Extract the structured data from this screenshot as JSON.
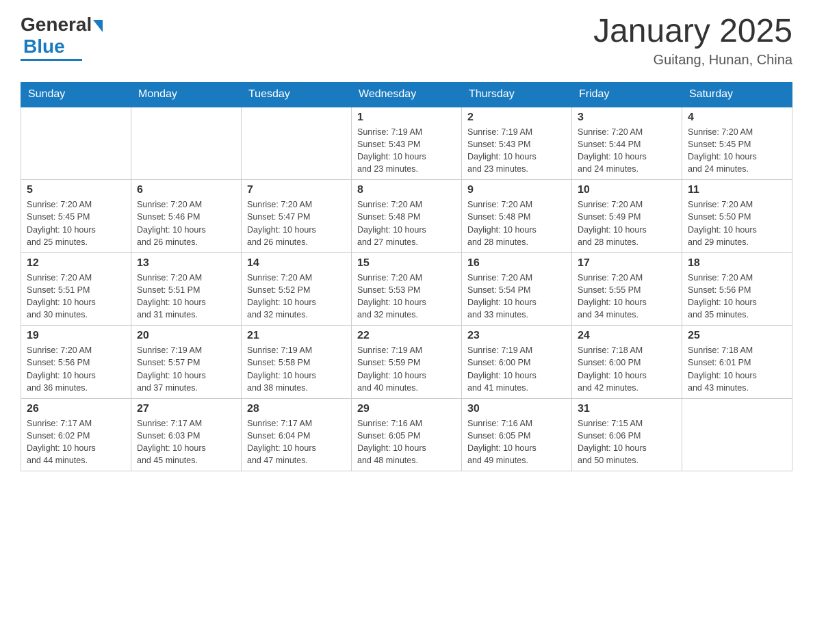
{
  "header": {
    "logo_general": "General",
    "logo_blue": "Blue",
    "month_title": "January 2025",
    "location": "Guitang, Hunan, China"
  },
  "days_of_week": [
    "Sunday",
    "Monday",
    "Tuesday",
    "Wednesday",
    "Thursday",
    "Friday",
    "Saturday"
  ],
  "weeks": [
    [
      {
        "day": "",
        "info": ""
      },
      {
        "day": "",
        "info": ""
      },
      {
        "day": "",
        "info": ""
      },
      {
        "day": "1",
        "info": "Sunrise: 7:19 AM\nSunset: 5:43 PM\nDaylight: 10 hours\nand 23 minutes."
      },
      {
        "day": "2",
        "info": "Sunrise: 7:19 AM\nSunset: 5:43 PM\nDaylight: 10 hours\nand 23 minutes."
      },
      {
        "day": "3",
        "info": "Sunrise: 7:20 AM\nSunset: 5:44 PM\nDaylight: 10 hours\nand 24 minutes."
      },
      {
        "day": "4",
        "info": "Sunrise: 7:20 AM\nSunset: 5:45 PM\nDaylight: 10 hours\nand 24 minutes."
      }
    ],
    [
      {
        "day": "5",
        "info": "Sunrise: 7:20 AM\nSunset: 5:45 PM\nDaylight: 10 hours\nand 25 minutes."
      },
      {
        "day": "6",
        "info": "Sunrise: 7:20 AM\nSunset: 5:46 PM\nDaylight: 10 hours\nand 26 minutes."
      },
      {
        "day": "7",
        "info": "Sunrise: 7:20 AM\nSunset: 5:47 PM\nDaylight: 10 hours\nand 26 minutes."
      },
      {
        "day": "8",
        "info": "Sunrise: 7:20 AM\nSunset: 5:48 PM\nDaylight: 10 hours\nand 27 minutes."
      },
      {
        "day": "9",
        "info": "Sunrise: 7:20 AM\nSunset: 5:48 PM\nDaylight: 10 hours\nand 28 minutes."
      },
      {
        "day": "10",
        "info": "Sunrise: 7:20 AM\nSunset: 5:49 PM\nDaylight: 10 hours\nand 28 minutes."
      },
      {
        "day": "11",
        "info": "Sunrise: 7:20 AM\nSunset: 5:50 PM\nDaylight: 10 hours\nand 29 minutes."
      }
    ],
    [
      {
        "day": "12",
        "info": "Sunrise: 7:20 AM\nSunset: 5:51 PM\nDaylight: 10 hours\nand 30 minutes."
      },
      {
        "day": "13",
        "info": "Sunrise: 7:20 AM\nSunset: 5:51 PM\nDaylight: 10 hours\nand 31 minutes."
      },
      {
        "day": "14",
        "info": "Sunrise: 7:20 AM\nSunset: 5:52 PM\nDaylight: 10 hours\nand 32 minutes."
      },
      {
        "day": "15",
        "info": "Sunrise: 7:20 AM\nSunset: 5:53 PM\nDaylight: 10 hours\nand 32 minutes."
      },
      {
        "day": "16",
        "info": "Sunrise: 7:20 AM\nSunset: 5:54 PM\nDaylight: 10 hours\nand 33 minutes."
      },
      {
        "day": "17",
        "info": "Sunrise: 7:20 AM\nSunset: 5:55 PM\nDaylight: 10 hours\nand 34 minutes."
      },
      {
        "day": "18",
        "info": "Sunrise: 7:20 AM\nSunset: 5:56 PM\nDaylight: 10 hours\nand 35 minutes."
      }
    ],
    [
      {
        "day": "19",
        "info": "Sunrise: 7:20 AM\nSunset: 5:56 PM\nDaylight: 10 hours\nand 36 minutes."
      },
      {
        "day": "20",
        "info": "Sunrise: 7:19 AM\nSunset: 5:57 PM\nDaylight: 10 hours\nand 37 minutes."
      },
      {
        "day": "21",
        "info": "Sunrise: 7:19 AM\nSunset: 5:58 PM\nDaylight: 10 hours\nand 38 minutes."
      },
      {
        "day": "22",
        "info": "Sunrise: 7:19 AM\nSunset: 5:59 PM\nDaylight: 10 hours\nand 40 minutes."
      },
      {
        "day": "23",
        "info": "Sunrise: 7:19 AM\nSunset: 6:00 PM\nDaylight: 10 hours\nand 41 minutes."
      },
      {
        "day": "24",
        "info": "Sunrise: 7:18 AM\nSunset: 6:00 PM\nDaylight: 10 hours\nand 42 minutes."
      },
      {
        "day": "25",
        "info": "Sunrise: 7:18 AM\nSunset: 6:01 PM\nDaylight: 10 hours\nand 43 minutes."
      }
    ],
    [
      {
        "day": "26",
        "info": "Sunrise: 7:17 AM\nSunset: 6:02 PM\nDaylight: 10 hours\nand 44 minutes."
      },
      {
        "day": "27",
        "info": "Sunrise: 7:17 AM\nSunset: 6:03 PM\nDaylight: 10 hours\nand 45 minutes."
      },
      {
        "day": "28",
        "info": "Sunrise: 7:17 AM\nSunset: 6:04 PM\nDaylight: 10 hours\nand 47 minutes."
      },
      {
        "day": "29",
        "info": "Sunrise: 7:16 AM\nSunset: 6:05 PM\nDaylight: 10 hours\nand 48 minutes."
      },
      {
        "day": "30",
        "info": "Sunrise: 7:16 AM\nSunset: 6:05 PM\nDaylight: 10 hours\nand 49 minutes."
      },
      {
        "day": "31",
        "info": "Sunrise: 7:15 AM\nSunset: 6:06 PM\nDaylight: 10 hours\nand 50 minutes."
      },
      {
        "day": "",
        "info": ""
      }
    ]
  ]
}
